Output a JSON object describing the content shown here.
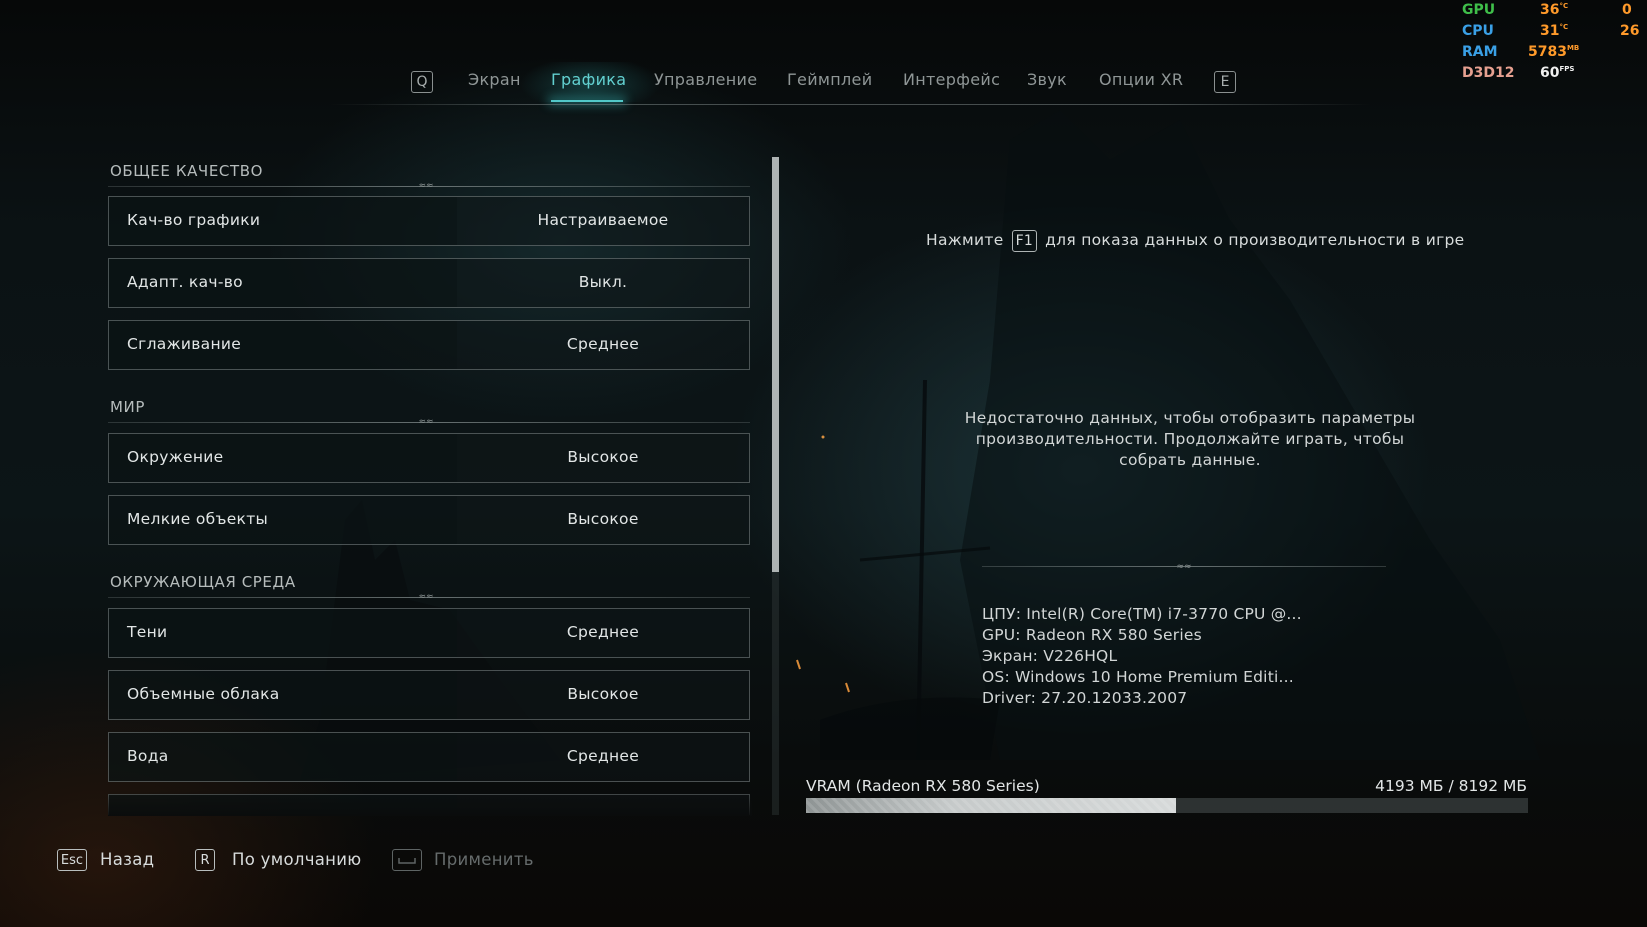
{
  "tabs": {
    "key_left": "Q",
    "key_right": "E",
    "items": [
      {
        "label": "Экран"
      },
      {
        "label": "Графика",
        "active": true
      },
      {
        "label": "Управление"
      },
      {
        "label": "Геймплей"
      },
      {
        "label": "Интерфейс"
      },
      {
        "label": "Звук"
      },
      {
        "label": "Опции XR"
      }
    ]
  },
  "overlay": {
    "gpu": {
      "label": "GPU",
      "temp": "36",
      "temp_unit": "°C",
      "load": "0"
    },
    "cpu": {
      "label": "CPU",
      "temp": "31",
      "temp_unit": "°C",
      "load": "26"
    },
    "ram": {
      "label": "RAM",
      "value": "5783",
      "unit": "MB"
    },
    "api": {
      "label": "D3D12",
      "fps": "60",
      "fps_unit": "FPS"
    },
    "colors": {
      "gpu": "#3fbf4a",
      "cpu": "#3aa0e6",
      "ram": "#3aa0e6",
      "api": "#e6a090",
      "value": "#ff9a2a"
    }
  },
  "sections": [
    {
      "title": "ОБЩЕЕ КАЧЕСТВО",
      "rows": [
        {
          "label": "Кач-во графики",
          "value": "Настраиваемое"
        },
        {
          "label": "Адапт. кач-во",
          "value": "Выкл."
        },
        {
          "label": "Сглаживание",
          "value": "Среднее"
        }
      ]
    },
    {
      "title": "МИР",
      "rows": [
        {
          "label": "Окружение",
          "value": "Высокое"
        },
        {
          "label": "Мелкие объекты",
          "value": "Высокое"
        }
      ]
    },
    {
      "title": "ОКРУЖАЮЩАЯ СРЕДА",
      "rows": [
        {
          "label": "Тени",
          "value": "Среднее"
        },
        {
          "label": "Объемные облака",
          "value": "Высокое"
        },
        {
          "label": "Вода",
          "value": "Среднее"
        }
      ]
    }
  ],
  "right_panel": {
    "hint_before": "Нажмите",
    "hint_key": "F1",
    "hint_after": "для показа данных о производительности в игре",
    "nodata_lines": [
      "Недостаточно данных, чтобы отобразить параметры",
      "производительности. Продолжайте играть, чтобы",
      "собрать данные."
    ],
    "sysinfo": [
      "ЦПУ: Intel(R) Core(TM) i7-3770 CPU @...",
      "GPU: Radeon RX 580 Series",
      "Экран: V226HQL",
      "OS: Windows 10 Home Premium Editi...",
      "Driver: 27.20.12033.2007"
    ],
    "vram": {
      "label": "VRAM (Radeon RX 580 Series)",
      "amount": "4193 МБ / 8192 МБ",
      "used_mb": 4193,
      "total_mb": 8192
    }
  },
  "scroll": {
    "thumb_fraction": 0.63
  },
  "bottom_bar": {
    "back_key": "Esc",
    "back_label": "Назад",
    "default_key": "R",
    "default_label": "По умолчанию",
    "apply_label": "Применить"
  }
}
